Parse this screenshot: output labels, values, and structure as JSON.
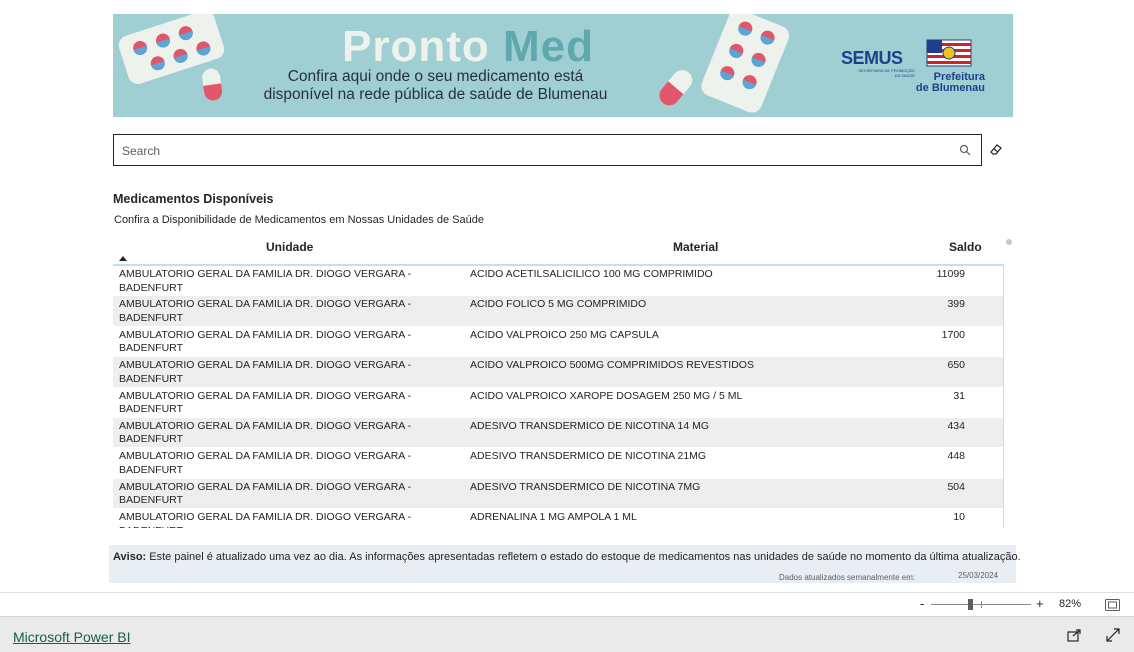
{
  "banner": {
    "brand_word1": "Pronto",
    "brand_word2": "Med",
    "tagline_line1": "Confira aqui onde o seu medicamento está",
    "tagline_line2": "disponível na rede pública de saúde de Blumenau",
    "semus": "SEMUS",
    "semus_sub": "SECRETARIA DE PROMOÇÃO DA SAÚDE",
    "prefeitura_line1": "Prefeitura",
    "prefeitura_line2": "de Blumenau"
  },
  "search": {
    "placeholder": "Search",
    "value": "",
    "icon": "search-icon",
    "clear_icon": "eraser-icon"
  },
  "visual": {
    "title": "Medicamentos Disponíveis",
    "subtitle": "Confira a Disponibilidade de Medicamentos em Nossas Unidades de Saúde"
  },
  "table": {
    "columns": [
      "Unidade",
      "Material",
      "Saldo"
    ],
    "sort_column": "Unidade",
    "sort_direction": "ascending",
    "rows": [
      {
        "unidade": "AMBULATORIO GERAL DA FAMILIA DR. DIOGO VERGARA - BADENFURT",
        "material": "ACIDO ACETILSALICILICO 100 MG COMPRIMIDO",
        "saldo": "11099"
      },
      {
        "unidade": "AMBULATORIO GERAL DA FAMILIA DR. DIOGO VERGARA - BADENFURT",
        "material": "ACIDO FOLICO 5 MG COMPRIMIDO",
        "saldo": "399"
      },
      {
        "unidade": "AMBULATORIO GERAL DA FAMILIA DR. DIOGO VERGARA - BADENFURT",
        "material": "ACIDO VALPROICO 250 MG CAPSULA",
        "saldo": "1700"
      },
      {
        "unidade": "AMBULATORIO GERAL DA FAMILIA DR. DIOGO VERGARA - BADENFURT",
        "material": "ACIDO VALPROICO 500MG COMPRIMIDOS REVESTIDOS",
        "saldo": "650"
      },
      {
        "unidade": "AMBULATORIO GERAL DA FAMILIA DR. DIOGO VERGARA - BADENFURT",
        "material": "ACIDO VALPROICO XAROPE DOSAGEM 250 MG / 5 ML",
        "saldo": "31"
      },
      {
        "unidade": "AMBULATORIO GERAL DA FAMILIA DR. DIOGO VERGARA - BADENFURT",
        "material": "ADESIVO TRANSDERMICO DE NICOTINA 14 MG",
        "saldo": "434"
      },
      {
        "unidade": "AMBULATORIO GERAL DA FAMILIA DR. DIOGO VERGARA - BADENFURT",
        "material": "ADESIVO TRANSDERMICO DE NICOTINA 21MG",
        "saldo": "448"
      },
      {
        "unidade": "AMBULATORIO GERAL DA FAMILIA DR. DIOGO VERGARA - BADENFURT",
        "material": "ADESIVO TRANSDERMICO DE NICOTINA 7MG",
        "saldo": "504"
      },
      {
        "unidade": "AMBULATORIO GERAL DA FAMILIA DR. DIOGO VERGARA - BADENFURT",
        "material": "ADRENALINA 1 MG AMPOLA 1 ML",
        "saldo": "10"
      }
    ]
  },
  "notice": {
    "label": "Aviso:",
    "text": " Este painel é atualizado uma vez ao dia. As informações apresentadas refletem o estado do estoque de medicamentos nas unidades de saúde no momento da última atualização.",
    "updated_label": "Dados atualizados semanalmente em:",
    "updated_date": "25/03/2024"
  },
  "zoom": {
    "minus": "-",
    "plus": "+",
    "level": "82%",
    "level_value": 82
  },
  "footer": {
    "link": "Microsoft Power BI",
    "share_icon": "share-icon",
    "expand_icon": "expand-icon"
  },
  "colors": {
    "banner_bg": "#a0cfd3",
    "brand_light": "#eef2ec",
    "brand_teal": "#5fa8ae",
    "semus_blue": "#1f3f8a",
    "pill_red": "#e0566a",
    "pill_blue": "#5aa6d6",
    "row_alt": "#eeeeee",
    "link_green": "#135e4d",
    "notice_bg": "#e9eef5"
  }
}
